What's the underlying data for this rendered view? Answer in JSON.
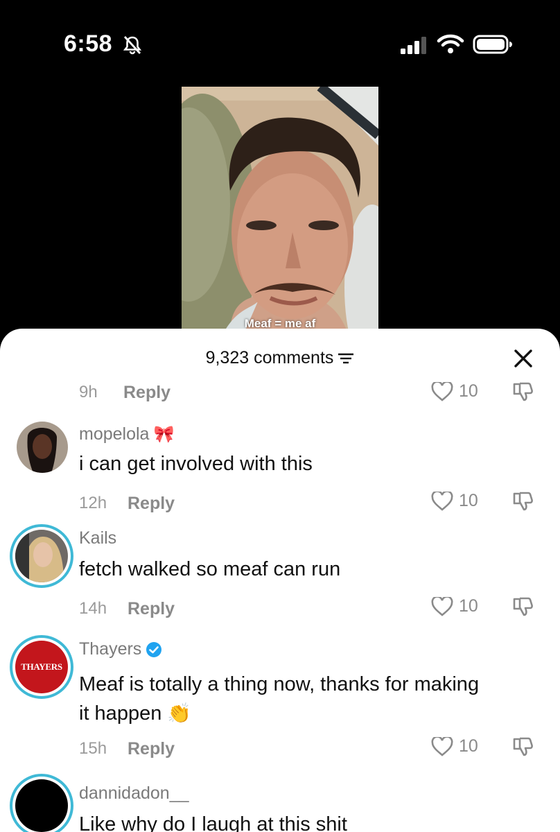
{
  "status_bar": {
    "time": "6:58"
  },
  "video": {
    "caption": "Meaf = me af"
  },
  "sheet": {
    "comments_count": "9,323 comments",
    "partial_meta": {
      "time": "9h",
      "reply": "Reply",
      "likes": "10"
    }
  },
  "comments": [
    {
      "username": "mopelola",
      "emoji": "🎀",
      "text": "i can get involved with this",
      "time": "12h",
      "reply": "Reply",
      "likes": "10"
    },
    {
      "username": "Kails",
      "text": "fetch walked so meaf can run",
      "time": "14h",
      "reply": "Reply",
      "likes": "10"
    },
    {
      "username": "Thayers",
      "avatar_text": "THAYERS",
      "text_line1": "Meaf is totally a thing now, thanks for making",
      "text_line2": "it happen",
      "emoji": "👏",
      "time": "15h",
      "reply": "Reply",
      "likes": "10"
    },
    {
      "username": "dannidadon__",
      "text": "Like why do I laugh at this shit"
    }
  ],
  "colors": {
    "accent_ring": "#3fb9d6",
    "verified": "#20a3f0",
    "thayers_red": "#c3161c"
  }
}
